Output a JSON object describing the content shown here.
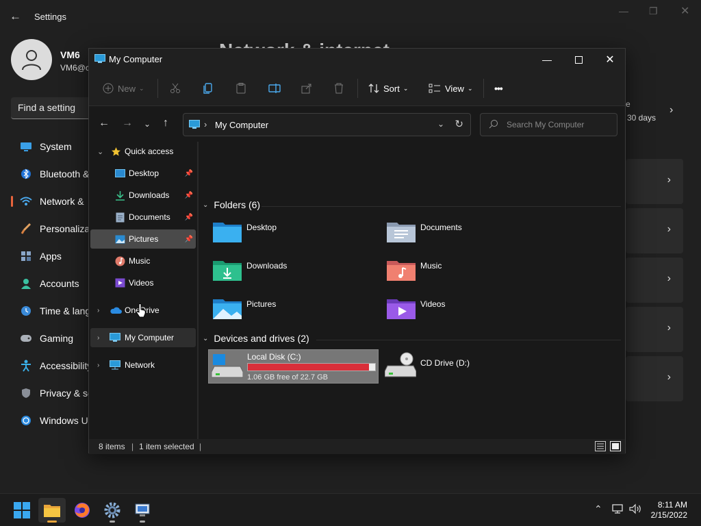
{
  "settings": {
    "title": "Settings",
    "user_name": "VM6",
    "user_sub": "VM6@c",
    "search_placeholder": "Find a setting",
    "page_title": "Network & internet",
    "right_text_1": "e",
    "right_text_2": "30 days",
    "nav": [
      {
        "label": "System",
        "icon": "monitor-icon"
      },
      {
        "label": "Bluetooth &",
        "icon": "bluetooth-icon"
      },
      {
        "label": "Network &",
        "icon": "wifi-icon"
      },
      {
        "label": "Personaliza",
        "icon": "brush-icon"
      },
      {
        "label": "Apps",
        "icon": "apps-icon"
      },
      {
        "label": "Accounts",
        "icon": "person-icon"
      },
      {
        "label": "Time & lang",
        "icon": "clock-globe-icon"
      },
      {
        "label": "Gaming",
        "icon": "gamepad-icon"
      },
      {
        "label": "Accessibility",
        "icon": "accessibility-icon"
      },
      {
        "label": "Privacy & se",
        "icon": "shield-icon"
      },
      {
        "label": "Windows U",
        "icon": "windows-update-icon"
      }
    ]
  },
  "explorer": {
    "title": "My Computer",
    "toolbar": {
      "new": "New",
      "sort": "Sort",
      "view": "View",
      "more": "•••"
    },
    "address": "My Computer",
    "search_placeholder": "Search My Computer",
    "sidebar": {
      "quick_access": "Quick access",
      "items": [
        "Desktop",
        "Downloads",
        "Documents",
        "Pictures",
        "Music",
        "Videos"
      ],
      "onedrive": "OneDrive",
      "my_computer": "My Computer",
      "network": "Network"
    },
    "folders_header": "Folders (6)",
    "folders": [
      "Desktop",
      "Documents",
      "Downloads",
      "Music",
      "Pictures",
      "Videos"
    ],
    "drives_header": "Devices and drives (2)",
    "drives": [
      {
        "label": "Local Disk (C:)",
        "free": "1.06 GB free of 22.7 GB",
        "used_fraction": 0.953
      },
      {
        "label": "CD Drive (D:)"
      }
    ],
    "status": {
      "items": "8 items",
      "selected": "1 item selected"
    },
    "colors": {
      "drive_bar": "#d92f3a",
      "accent": "#e8643c"
    }
  },
  "taskbar": {
    "time": "8:11 AM",
    "date": "2/15/2022"
  }
}
